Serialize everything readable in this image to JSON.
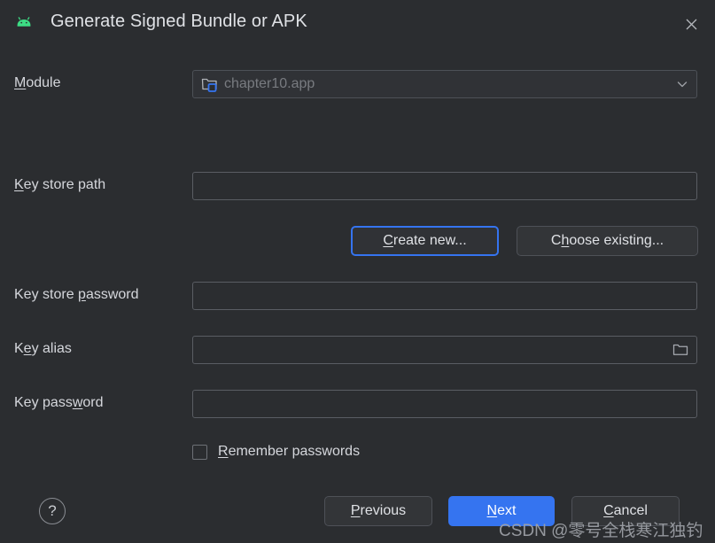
{
  "window": {
    "title": "Generate Signed Bundle or APK",
    "app_icon": "android-robot-icon",
    "close_label": "✕"
  },
  "form": {
    "module": {
      "label": "Module",
      "mnemonic": "M",
      "label_rest": "odule",
      "value": "chapter10.app",
      "icon": "module-folder-icon",
      "dropdown_icon": "chevron-down-icon"
    },
    "key_store_path": {
      "label_mnemonic": "K",
      "label_rest": "ey store path",
      "value": "",
      "placeholder": ""
    },
    "key_store_password": {
      "label_pre": "Key store ",
      "label_mnemonic": "p",
      "label_rest": "assword",
      "value": "",
      "placeholder": ""
    },
    "key_alias": {
      "label_pre": "K",
      "label_mnemonic": "e",
      "label_rest": "y alias",
      "value": "",
      "placeholder": "",
      "browse_icon": "folder-icon"
    },
    "key_password": {
      "label_pre": "Key pass",
      "label_mnemonic": "w",
      "label_rest": "ord",
      "value": "",
      "placeholder": ""
    },
    "remember_passwords": {
      "label_mnemonic": "R",
      "label_rest": "emember passwords",
      "checked": false
    }
  },
  "keystore_buttons": {
    "create_new": {
      "mnemonic": "C",
      "rest": "reate new...",
      "focused": true
    },
    "choose_existing": {
      "pre": "C",
      "mnemonic": "h",
      "rest": "oose existing..."
    }
  },
  "footer": {
    "help": "?",
    "previous": {
      "mnemonic": "P",
      "rest": "revious"
    },
    "next": {
      "mnemonic": "N",
      "rest": "ext",
      "primary": true
    },
    "cancel": {
      "mnemonic": "C",
      "rest": "ancel"
    }
  },
  "watermark": "CSDN @零号全栈寒江独钓",
  "colors": {
    "background": "#2b2d30",
    "accent": "#3574f0",
    "text": "#dfe1e5",
    "muted_text": "#787b80",
    "border": "#5a5d63",
    "android_green": "#3ddc84"
  }
}
